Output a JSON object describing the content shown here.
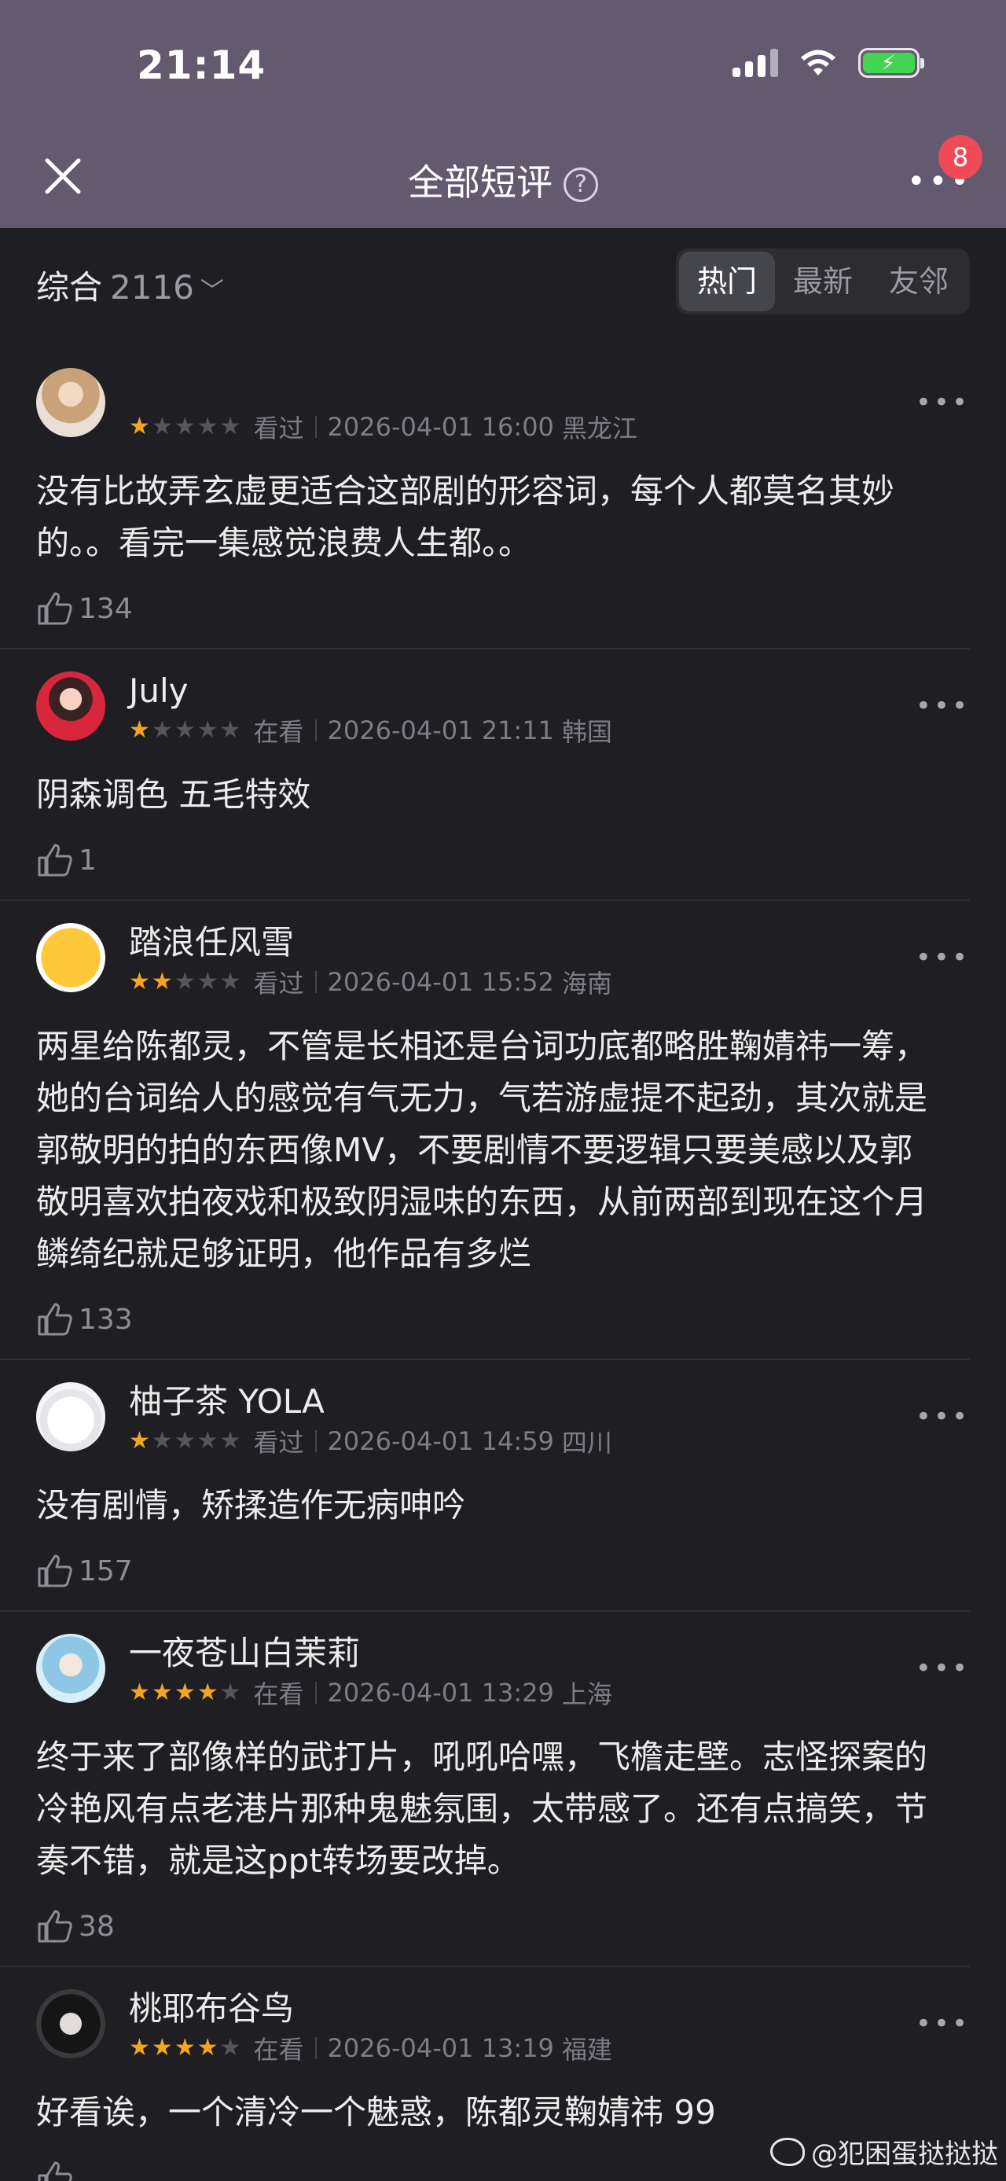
{
  "status": {
    "time": "21:14"
  },
  "nav": {
    "title": "全部短评",
    "help": "?",
    "badge": "8"
  },
  "filter": {
    "sort_label": "综合",
    "sort_count": "2116",
    "tabs": [
      "热门",
      "最新",
      "友邻"
    ],
    "active_tab": "热门"
  },
  "colors": {
    "header": "#645a70",
    "star_on": "#f3a422",
    "badge": "#f04a57"
  },
  "reviews": [
    {
      "name": "",
      "stars": 1,
      "status": "看过",
      "datetime": "2026-04-01 16:00",
      "location": "黑龙江",
      "text": "没有比故弄玄虚更适合这部剧的形容词，每个人都莫名其妙的。。看完一集感觉浪费人生都。。",
      "likes": "134",
      "avatar": "anime-girl-avatar"
    },
    {
      "name": "July",
      "stars": 1,
      "status": "在看",
      "datetime": "2026-04-01 21:11",
      "location": "韩国",
      "text": "阴森调色 五毛特效",
      "likes": "1",
      "avatar": "girl-red-avatar"
    },
    {
      "name": "踏浪任风雪",
      "stars": 2,
      "status": "看过",
      "datetime": "2026-04-01 15:52",
      "location": "海南",
      "text": "两星给陈都灵，不管是长相还是台词功底都略胜鞠婧祎一筹，她的台词给人的感觉有气无力，气若游虚提不起劲，其次就是郭敬明的拍的东西像MV，不要剧情不要逻辑只要美感以及郭敬明喜欢拍夜戏和极致阴湿味的东西，从前两部到现在这个月鳞绮纪就足够证明，他作品有多烂",
      "likes": "133",
      "avatar": "emoji-face-avatar"
    },
    {
      "name": "柚子茶 YOLA",
      "stars": 1,
      "status": "看过",
      "datetime": "2026-04-01 14:59",
      "location": "四川",
      "text": "没有剧情，矫揉造作无病呻吟",
      "likes": "157",
      "avatar": "white-cat-avatar"
    },
    {
      "name": "一夜苍山白茉莉",
      "stars": 4,
      "status": "在看",
      "datetime": "2026-04-01 13:29",
      "location": "上海",
      "text": "终于来了部像样的武打片，吼吼哈嘿，飞檐走壁。志怪探案的冷艳风有点老港片那种鬼魅氛围，太带感了。还有点搞笑，节奏不错，就是这ppt转场要改掉。",
      "likes": "38",
      "avatar": "blue-hair-avatar"
    },
    {
      "name": "桃耶布谷鸟",
      "stars": 4,
      "status": "在看",
      "datetime": "2026-04-01 13:19",
      "location": "福建",
      "text": "好看诶，一个清冷一个魅惑，陈都灵鞠婧祎 99",
      "likes": "",
      "avatar": "dark-hair-avatar"
    }
  ],
  "watermark": "@犯困蛋挞挞挞"
}
